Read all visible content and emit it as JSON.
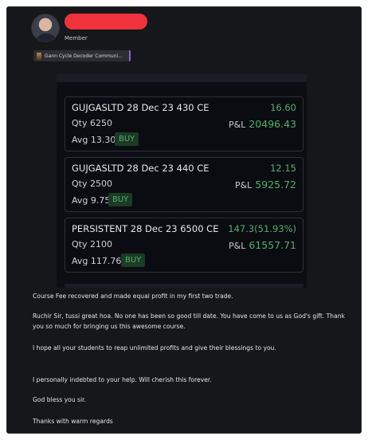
{
  "header": {
    "role": "Member",
    "community_tag": "Gann Cycle Decoder Communi..."
  },
  "trades": [
    {
      "name": "GUJGASLTD 28 Dec 23 430 CE",
      "change": "16.60",
      "qty_label": "Qty",
      "qty": "6250",
      "pnl_label": "P&L",
      "pnl": "20496.43",
      "avg_label": "Avg",
      "avg": "13.30",
      "action": "BUY"
    },
    {
      "name": "GUJGASLTD 28 Dec 23 440 CE",
      "change": "12.15",
      "qty_label": "Qty",
      "qty": "2500",
      "pnl_label": "P&L",
      "pnl": "5925.72",
      "avg_label": "Avg",
      "avg": "9.75",
      "action": "BUY"
    },
    {
      "name": "PERSISTENT 28 Dec 23 6500 CE",
      "change": "147.3(51.93%)",
      "qty_label": "Qty",
      "qty": "2100",
      "pnl_label": "P&L",
      "pnl": "61557.71",
      "avg_label": "Avg",
      "avg": "117.76",
      "action": "BUY"
    }
  ],
  "message": {
    "p1": "Course Fee recovered and made equal profit in my first two trade.",
    "p2": "Ruchir Sir, tussi great hoa. No one has been so good till date. You have come to us as God's gift. Thank you so much for bringing us this awesome course.",
    "p3": "I hope all your students to reap unlimited profits and give their blessings to you.",
    "p4": "I personally indebted to your help. Will cherish this forever.",
    "p5": "God bless you sir.",
    "p6": "Thanks with warm regards"
  },
  "colors": {
    "background": "#16171b",
    "profit_green": "#4fb069",
    "redaction": "#f0323c",
    "tag_accent": "#8a5cf5"
  }
}
